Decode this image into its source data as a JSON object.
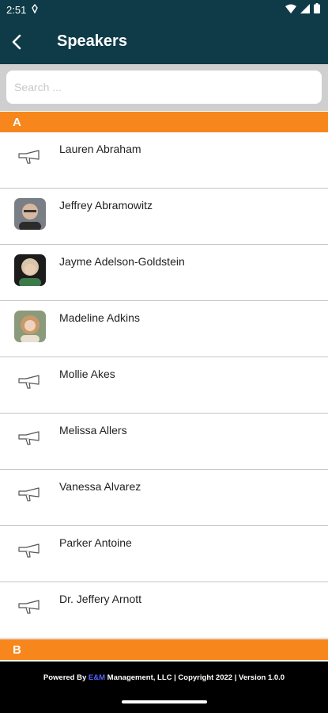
{
  "status_bar": {
    "time": "2:51"
  },
  "app_bar": {
    "title": "Speakers"
  },
  "search": {
    "placeholder": "Search ..."
  },
  "sections": [
    {
      "letter": "A",
      "speakers": [
        {
          "name": "Lauren Abraham",
          "photo": false
        },
        {
          "name": "Jeffrey Abramowitz",
          "photo": true
        },
        {
          "name": "Jayme Adelson-Goldstein",
          "photo": true
        },
        {
          "name": "Madeline Adkins",
          "photo": true
        },
        {
          "name": "Mollie Akes",
          "photo": false
        },
        {
          "name": "Melissa Allers",
          "photo": false
        },
        {
          "name": "Vanessa Alvarez",
          "photo": false
        },
        {
          "name": "Parker Antoine",
          "photo": false
        },
        {
          "name": "Dr. Jeffery Arnott",
          "photo": false
        }
      ]
    },
    {
      "letter": "B",
      "speakers": []
    }
  ],
  "footer": {
    "prefix": "Powered By ",
    "brand": "E&M",
    "suffix": " Management, LLC | Copyright 2022 | Version 1.0.0"
  },
  "colors": {
    "app_bar": "#0e3b47",
    "section_header": "#f7861c",
    "footer_brand": "#5a63ff"
  }
}
